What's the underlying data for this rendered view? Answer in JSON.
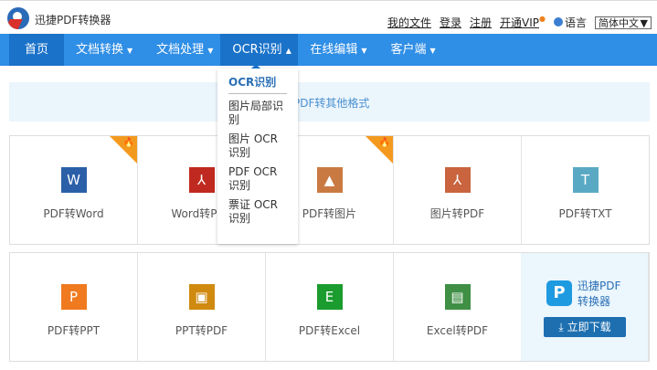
{
  "header": {
    "brand": "迅捷PDF转换器",
    "links": [
      "我的文件",
      "登录",
      "注册",
      "开通VIP"
    ],
    "vip_dot": "●",
    "language_label": "语言",
    "language_value": "简体中文"
  },
  "nav": {
    "items": [
      {
        "label": "首页"
      },
      {
        "label": "文档转换"
      },
      {
        "label": "文档处理"
      },
      {
        "label": "OCR识别"
      },
      {
        "label": "在线编辑"
      },
      {
        "label": "客户端"
      }
    ],
    "caret_down": "▼",
    "caret_up": "▲"
  },
  "banner": {
    "text": "PDF转其他格式"
  },
  "dropdown": {
    "title": "OCR识别",
    "items": [
      "图片局部识别",
      "图片 OCR 识别",
      "PDF OCR识别",
      "票证 OCR 识别"
    ]
  },
  "tools_row1": [
    {
      "label": "PDF转Word",
      "glyph": "W",
      "color": "#2b5fa8",
      "hot": true
    },
    {
      "label": "Word转PDF",
      "glyph": "⅄",
      "color": "#c0291f",
      "hot": false
    },
    {
      "label": "PDF转图片",
      "glyph": "▲",
      "color": "#c97a42",
      "hot": true
    },
    {
      "label": "图片转PDF",
      "glyph": "⅄",
      "color": "#c9643f",
      "hot": false
    },
    {
      "label": "PDF转TXT",
      "glyph": "T",
      "color": "#5aa9c4",
      "hot": false
    }
  ],
  "tools_row2": [
    {
      "label": "PDF转PPT",
      "glyph": "P",
      "color": "#f07a20"
    },
    {
      "label": "PPT转PDF",
      "glyph": "▣",
      "color": "#d08a10"
    },
    {
      "label": "PDF转Excel",
      "glyph": "E",
      "color": "#1a9c2e"
    },
    {
      "label": "Excel转PDF",
      "glyph": "▤",
      "color": "#3f8f45"
    }
  ],
  "download": {
    "logo": "P",
    "name_line1": "迅捷PDF",
    "name_line2": "转换器",
    "button": "立即下载",
    "button_icon": "⤓"
  },
  "hot_icon": "🔥"
}
